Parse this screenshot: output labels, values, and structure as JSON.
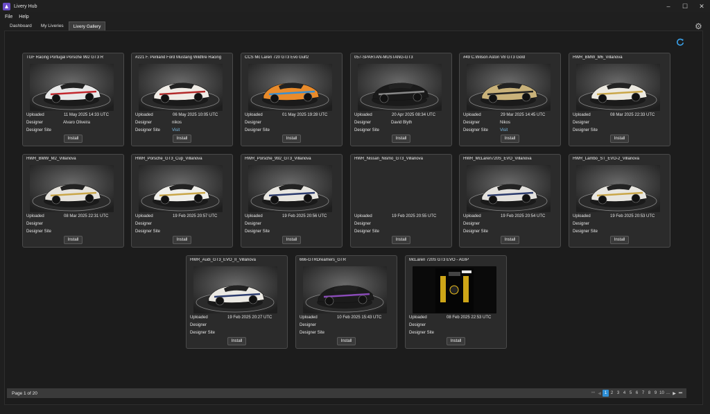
{
  "window": {
    "title": "Livery Hub"
  },
  "menu": {
    "file": "File",
    "help": "Help"
  },
  "tabs": {
    "dashboard": "Dashboard",
    "my_liveries": "My Liveries",
    "gallery": "Livery Gallery"
  },
  "labels": {
    "uploaded": "Uploaded",
    "designer": "Designer",
    "designer_site": "Designer Site",
    "install": "Install"
  },
  "cards": [
    {
      "title": "TGF Racing Portugal Porsche 992 GT3 R",
      "uploaded": "11 May 2025 14:33 UTC",
      "designer": "Alvaro Oliveira",
      "site": "",
      "car_color": "#e8e8e8",
      "accent": "#c2272d"
    },
    {
      "title": "#221 F. Penland Ford Mustang Wildfire Racing",
      "uploaded": "06 May 2025 10:05 UTC",
      "designer": "nikos",
      "site": "Visit",
      "car_color": "#f0ece6",
      "accent": "#b22a2a"
    },
    {
      "title": "CCS Mc Laren 720 GT3 Evo Gulf2",
      "uploaded": "01 May 2025 19:28 UTC",
      "designer": "",
      "site": "",
      "car_color": "#e98b2b",
      "accent": "#3a8fd0"
    },
    {
      "title": "057-SPARTAN-MUSTANG-GT3",
      "uploaded": "20 Apr 2025 08:34 UTC",
      "designer": "David Blyth",
      "site": "",
      "car_color": "#1a1a1a",
      "accent": "#8a8a8a"
    },
    {
      "title": "#49 C.Wilson Aston V8 GT3 Gold",
      "uploaded": "29 Mar 2025 14:45 UTC",
      "designer": "Nikos",
      "site": "Visit",
      "car_color": "#c9b27a",
      "accent": "#222"
    },
    {
      "title": "HWR_BMW_M6_Villanova",
      "uploaded": "08 Mar 2025 22:33 UTC",
      "designer": "",
      "site": "",
      "car_color": "#ece9e0",
      "accent": "#c9a648"
    },
    {
      "title": "HWR_BMW_M2_Villanova",
      "uploaded": "08 Mar 2025 22:31 UTC",
      "designer": "",
      "site": "",
      "car_color": "#e6e3dc",
      "accent": "#c9a648"
    },
    {
      "title": "HWR_Porsche_GT3_Cup_Villanova",
      "uploaded": "19 Feb 2025 20:57 UTC",
      "designer": "",
      "site": "",
      "car_color": "#f0efea",
      "accent": "#c9a648"
    },
    {
      "title": "HWR_Porsche_992_GT3_Villanova",
      "uploaded": "19 Feb 2025 20:56 UTC",
      "designer": "",
      "site": "",
      "car_color": "#e8e6e0",
      "accent": "#2b3b6e"
    },
    {
      "title": "HWR_Nissan_Nismo_GT3_Villanova",
      "uploaded": "19 Feb 2025 20:55 UTC",
      "designer": "",
      "site": "",
      "car_color": "",
      "accent": ""
    },
    {
      "title": "HWR_McLaren720S_EVO_Villanova",
      "uploaded": "19 Feb 2025 20:54 UTC",
      "designer": "",
      "site": "",
      "car_color": "#e4e2de",
      "accent": "#2b3b6e"
    },
    {
      "title": "HWR_Lambo_ST_EVO-2_Villanova",
      "uploaded": "19 Feb 2025 20:53 UTC",
      "designer": "",
      "site": "",
      "car_color": "#e8e6e0",
      "accent": "#c9a648"
    },
    {
      "title": "HWR_Audi_GT3_EVO_II_Villanova",
      "uploaded": "19 Feb 2025 20:27 UTC",
      "designer": "",
      "site": "",
      "car_color": "#ebe9e3",
      "accent": "#2b3b6e"
    },
    {
      "title": "666-GTRDreamers_GTR",
      "uploaded": "10 Feb 2025 15:43 UTC",
      "designer": "",
      "site": "",
      "car_color": "#1b1b1b",
      "accent": "#8a4bb8"
    },
    {
      "title": "McLaren 720S GT3 EVO - AGIP",
      "uploaded": "08 Feb 2025 22:53 UTC",
      "designer": "",
      "site": "",
      "car_color": "#050505",
      "accent": "#f1c21b"
    }
  ],
  "pager": {
    "info": "Page 1 of 20",
    "first": "⏮",
    "prev": "◀",
    "pages": [
      "1",
      "2",
      "3",
      "4",
      "5",
      "6",
      "7",
      "8",
      "9",
      "10"
    ],
    "ellipsis": "...",
    "next": "▶",
    "last": "⏭",
    "current": 1
  },
  "colors": {
    "accent": "#2f8fd6",
    "link": "#7fbfe8"
  },
  "icons": {
    "refresh": "refresh-icon",
    "settings": "gear-icon"
  }
}
